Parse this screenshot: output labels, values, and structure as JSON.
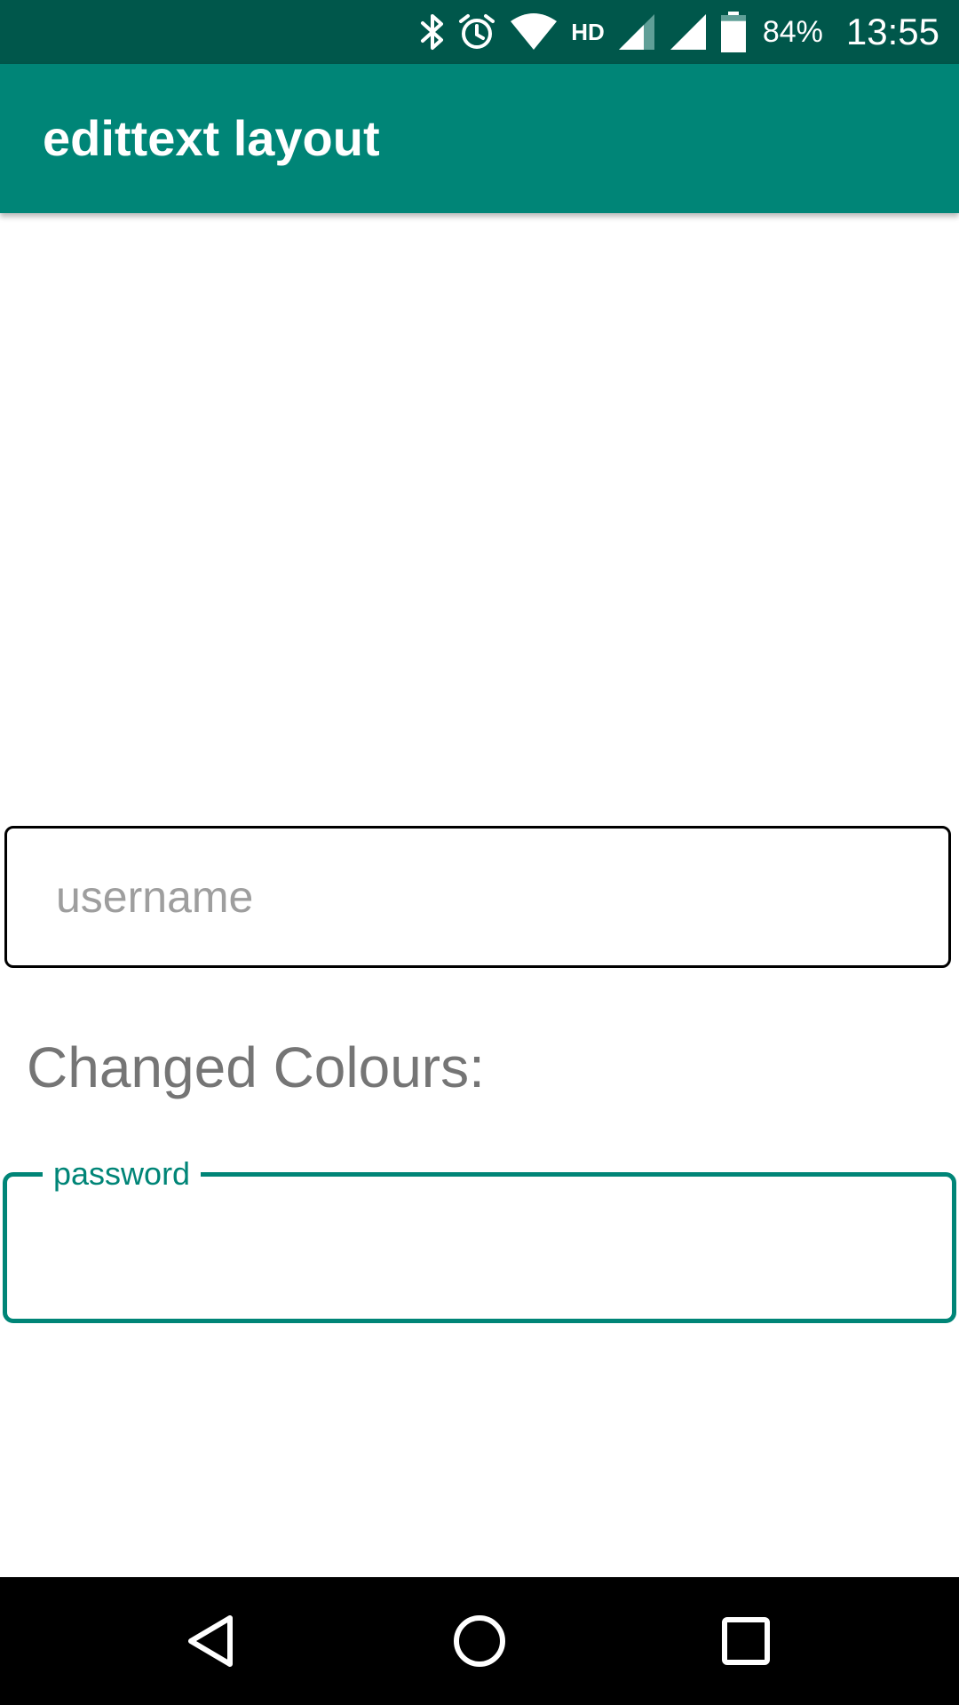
{
  "status_bar": {
    "icons": [
      "bluetooth-icon",
      "alarm-icon",
      "wifi-icon",
      "hd-icon",
      "signal-icon",
      "signal-icon",
      "battery-icon"
    ],
    "hd_label": "HD",
    "battery_percent": "84%",
    "battery_level": 0.84,
    "clock": "13:55"
  },
  "app_bar": {
    "title": "edittext layout",
    "color": "#008577"
  },
  "form": {
    "username": {
      "placeholder": "username",
      "value": ""
    },
    "section_label": "Changed Colours:",
    "password": {
      "label": "password",
      "value": "",
      "accent_color": "#008577"
    }
  },
  "nav_bar": {
    "buttons": [
      "back-icon",
      "home-icon",
      "recents-icon"
    ]
  }
}
